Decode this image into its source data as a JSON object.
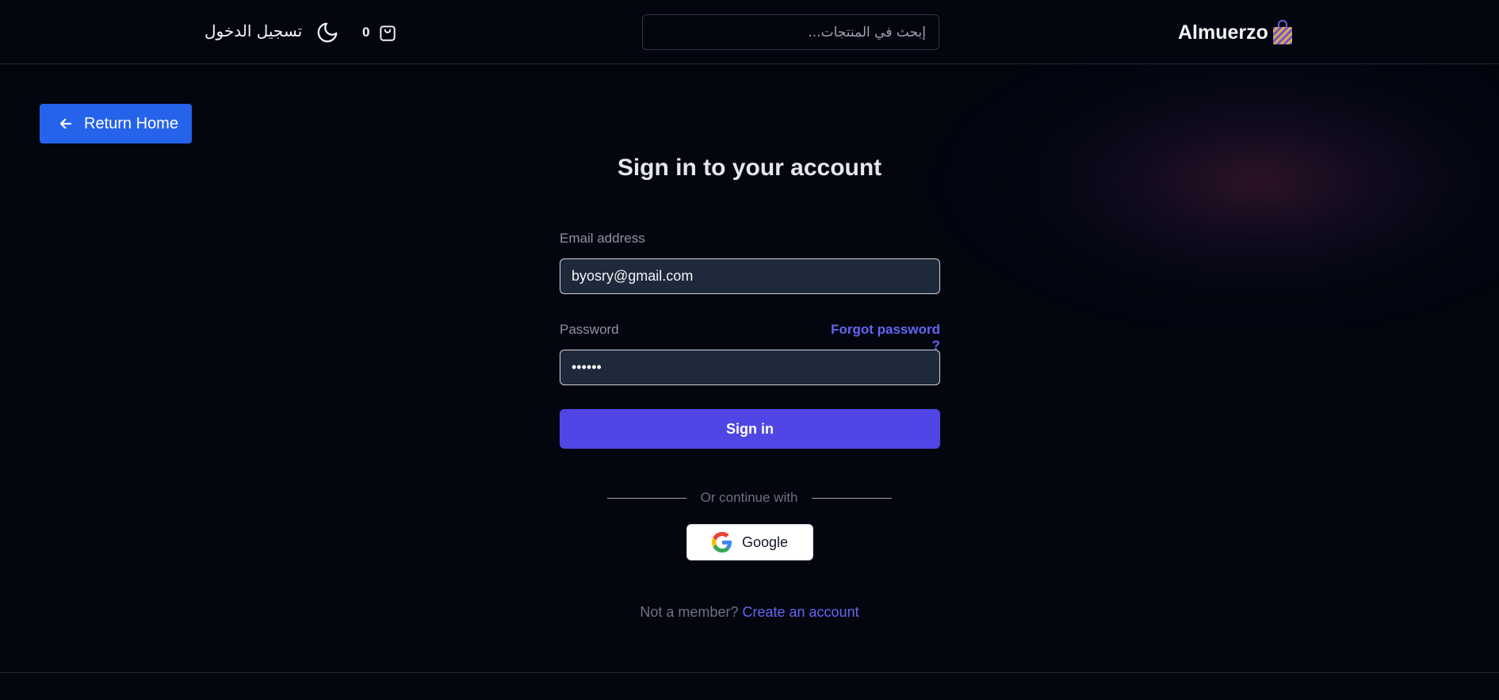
{
  "header": {
    "brand_name": "Almuerzo",
    "search_placeholder": "إبحث في المنتجات...",
    "cart_count": "0",
    "login_label": "تسجيل الدخول"
  },
  "nav": {
    "return_home_label": "Return Home"
  },
  "form": {
    "title": "Sign in to your account",
    "email_label": "Email address",
    "email_value": "byosry@gmail.com",
    "password_label": "Password",
    "password_value": "••••••",
    "forgot_label": "Forgot password ?",
    "signin_label": "Sign in",
    "divider_text": "Or continue with",
    "google_label": "Google",
    "member_text": "Not a member?",
    "create_account_label": "Create an account"
  },
  "icons": {
    "brand": "shopping-bag-icon",
    "cart": "shopping-bag-cart-icon",
    "theme": "moon-icon",
    "back": "arrow-left-icon",
    "google": "google-logo-icon"
  },
  "colors": {
    "background": "#03060f",
    "primary_blue": "#2563eb",
    "indigo": "#4f46e5",
    "link": "#6366f1",
    "input_bg": "#1e293b"
  }
}
